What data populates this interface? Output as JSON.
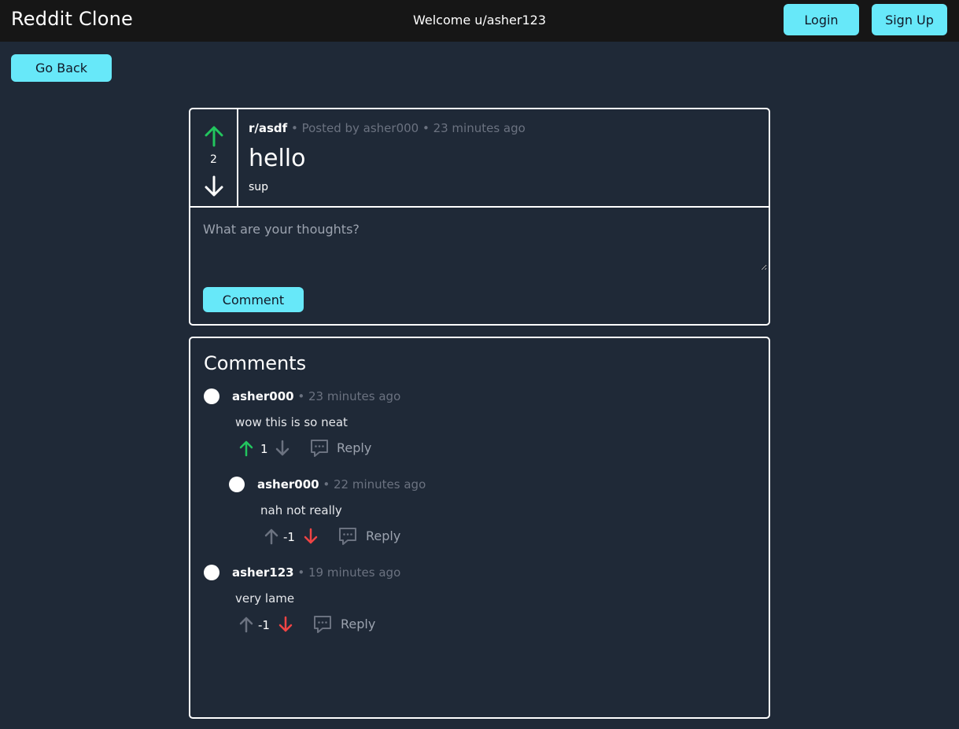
{
  "header": {
    "brand": "Reddit Clone",
    "welcome": "Welcome u/asher123",
    "login_label": "Login",
    "signup_label": "Sign Up"
  },
  "nav": {
    "back_label": "Go Back"
  },
  "post": {
    "score": "2",
    "subreddit": "r/asdf",
    "meta": " • Posted by asher000 • 23 minutes ago",
    "title": "hello",
    "body": "sup",
    "upvoted": true
  },
  "comment_form": {
    "placeholder": "What are your thoughts?",
    "value": "",
    "submit_label": "Comment"
  },
  "comments_section": {
    "heading": "Comments",
    "reply_label": "Reply",
    "items": [
      {
        "author": "asher000",
        "time": " • 23 minutes ago",
        "text": "wow this is so neat",
        "score": "1",
        "vote": "up"
      },
      {
        "author": "asher000",
        "time": " • 22 minutes ago",
        "text": "nah not really",
        "score": "-1",
        "vote": "down"
      },
      {
        "author": "asher123",
        "time": " • 19 minutes ago",
        "text": "very lame",
        "score": "-1",
        "vote": "down"
      }
    ]
  },
  "colors": {
    "background": "#1f2937",
    "topbar": "#161616",
    "accent": "#67e8f9",
    "upvote": "#22c55e",
    "downvote": "#ef4444",
    "muted": "#6b7280"
  },
  "icons": {
    "upvote": "arrow-up-icon",
    "downvote": "arrow-down-icon",
    "reply": "comment-bubble-icon",
    "avatar": "avatar-dot"
  }
}
